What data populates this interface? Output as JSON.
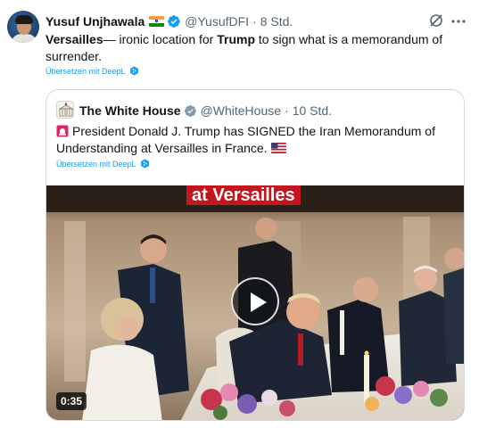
{
  "tweet": {
    "author": {
      "display_name": "Yusuf Unjhawala",
      "handle": "@YusufDFI",
      "flag": "india-flag-icon",
      "verified": true
    },
    "separator": "·",
    "time": "8 Std.",
    "text_parts": [
      {
        "text": "Versailles",
        "bold": true
      },
      {
        "text": "— ironic location for ",
        "bold": false
      },
      {
        "text": "Trump",
        "bold": true
      },
      {
        "text": " to sign what is a memorandum of surrender.",
        "bold": false
      }
    ],
    "translate_label": "Übersetzen mit DeepL",
    "actions": {
      "grok_icon": "grok-icon",
      "more_icon": "more-options-icon"
    }
  },
  "quote": {
    "author": {
      "display_name": "The White House",
      "handle": "@WhiteHouse",
      "verified": true,
      "verified_type": "government-gray"
    },
    "separator": "·",
    "time": "10 Std.",
    "text": "President Donald J. Trump has SIGNED the Iran Memorandum of Understanding at Versailles in France.",
    "leading_emoji": "siren-icon",
    "trailing_emoji": "us-flag-icon",
    "translate_label": "Übersetzen mit DeepL",
    "media": {
      "type": "video",
      "caption_overlay": "at Versailles",
      "duration": "0:35"
    }
  },
  "colors": {
    "link_blue": "#1d9bf0",
    "text_primary": "#0f1419",
    "text_secondary": "#536471",
    "border": "#cfd9de",
    "caption_red": "#c4161c"
  }
}
